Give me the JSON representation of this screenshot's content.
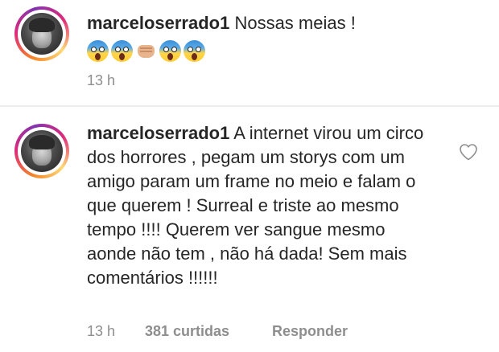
{
  "comments": [
    {
      "username": "marceloserrado1",
      "text": "Nossas meias !",
      "emojis": [
        "face-screaming-in-fear",
        "face-screaming-in-fear",
        "oncoming-fist",
        "face-screaming-in-fear",
        "face-screaming-in-fear"
      ],
      "time": "13 h"
    },
    {
      "username": "marceloserrado1",
      "text": "A internet virou um circo dos horrores , pegam um storys com um amigo param um frame no meio e falam o que querem ! Surreal e triste ao mesmo tempo !!!! Querem ver sangue mesmo aonde não tem , não há dada! Sem mais comentários !!!!!!",
      "time": "13 h",
      "likes": "381 curtidas",
      "reply": "Responder",
      "like_icon": "heart-outline-icon"
    }
  ],
  "colors": {
    "text": "#262626",
    "meta": "#8e8e8e",
    "divider": "#ececec"
  }
}
